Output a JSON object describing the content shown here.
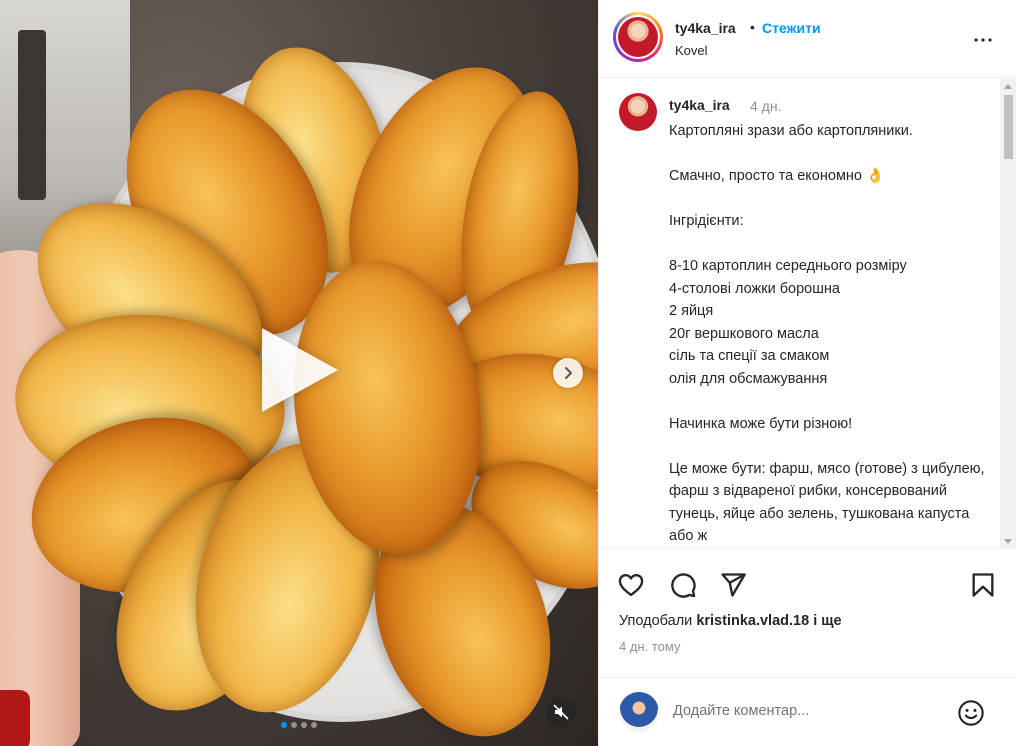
{
  "media": {
    "carousel_dots": 4,
    "active_dot": 0
  },
  "header": {
    "username": "ty4ka_ira",
    "separator": "•",
    "follow_label": "Стежити",
    "location": "Kovel"
  },
  "caption": {
    "username": "ty4ka_ira",
    "time": "4 дн.",
    "text": "Картопляні зрази або картопляники.\n\nСмачно, просто та економно 👌\n\nІнгрідієнти:\n\n8-10 картоплин середнього розміру\n4-столові ложки борошна\n2 яйця\n20г вершкового масла\nсіль та спеції за смаком\nолія для обсмажування\n\nНачинка може бути різною!\n\nЦе може бути: фарш, мясо (готове) з цибулею, фарш з відвареної рибки, консервований тунець, яйце або зелень, тушкована капуста або ж"
  },
  "likes": {
    "prefix": "Уподобали",
    "user": "kristinka.vlad.18",
    "suffix": "і ще"
  },
  "post_date": "4 дн. тому",
  "comment": {
    "placeholder": "Додайте коментар..."
  },
  "colors": {
    "accent": "#0095f6",
    "text": "#262626",
    "muted": "#8e8e8e",
    "border": "#efefef"
  }
}
